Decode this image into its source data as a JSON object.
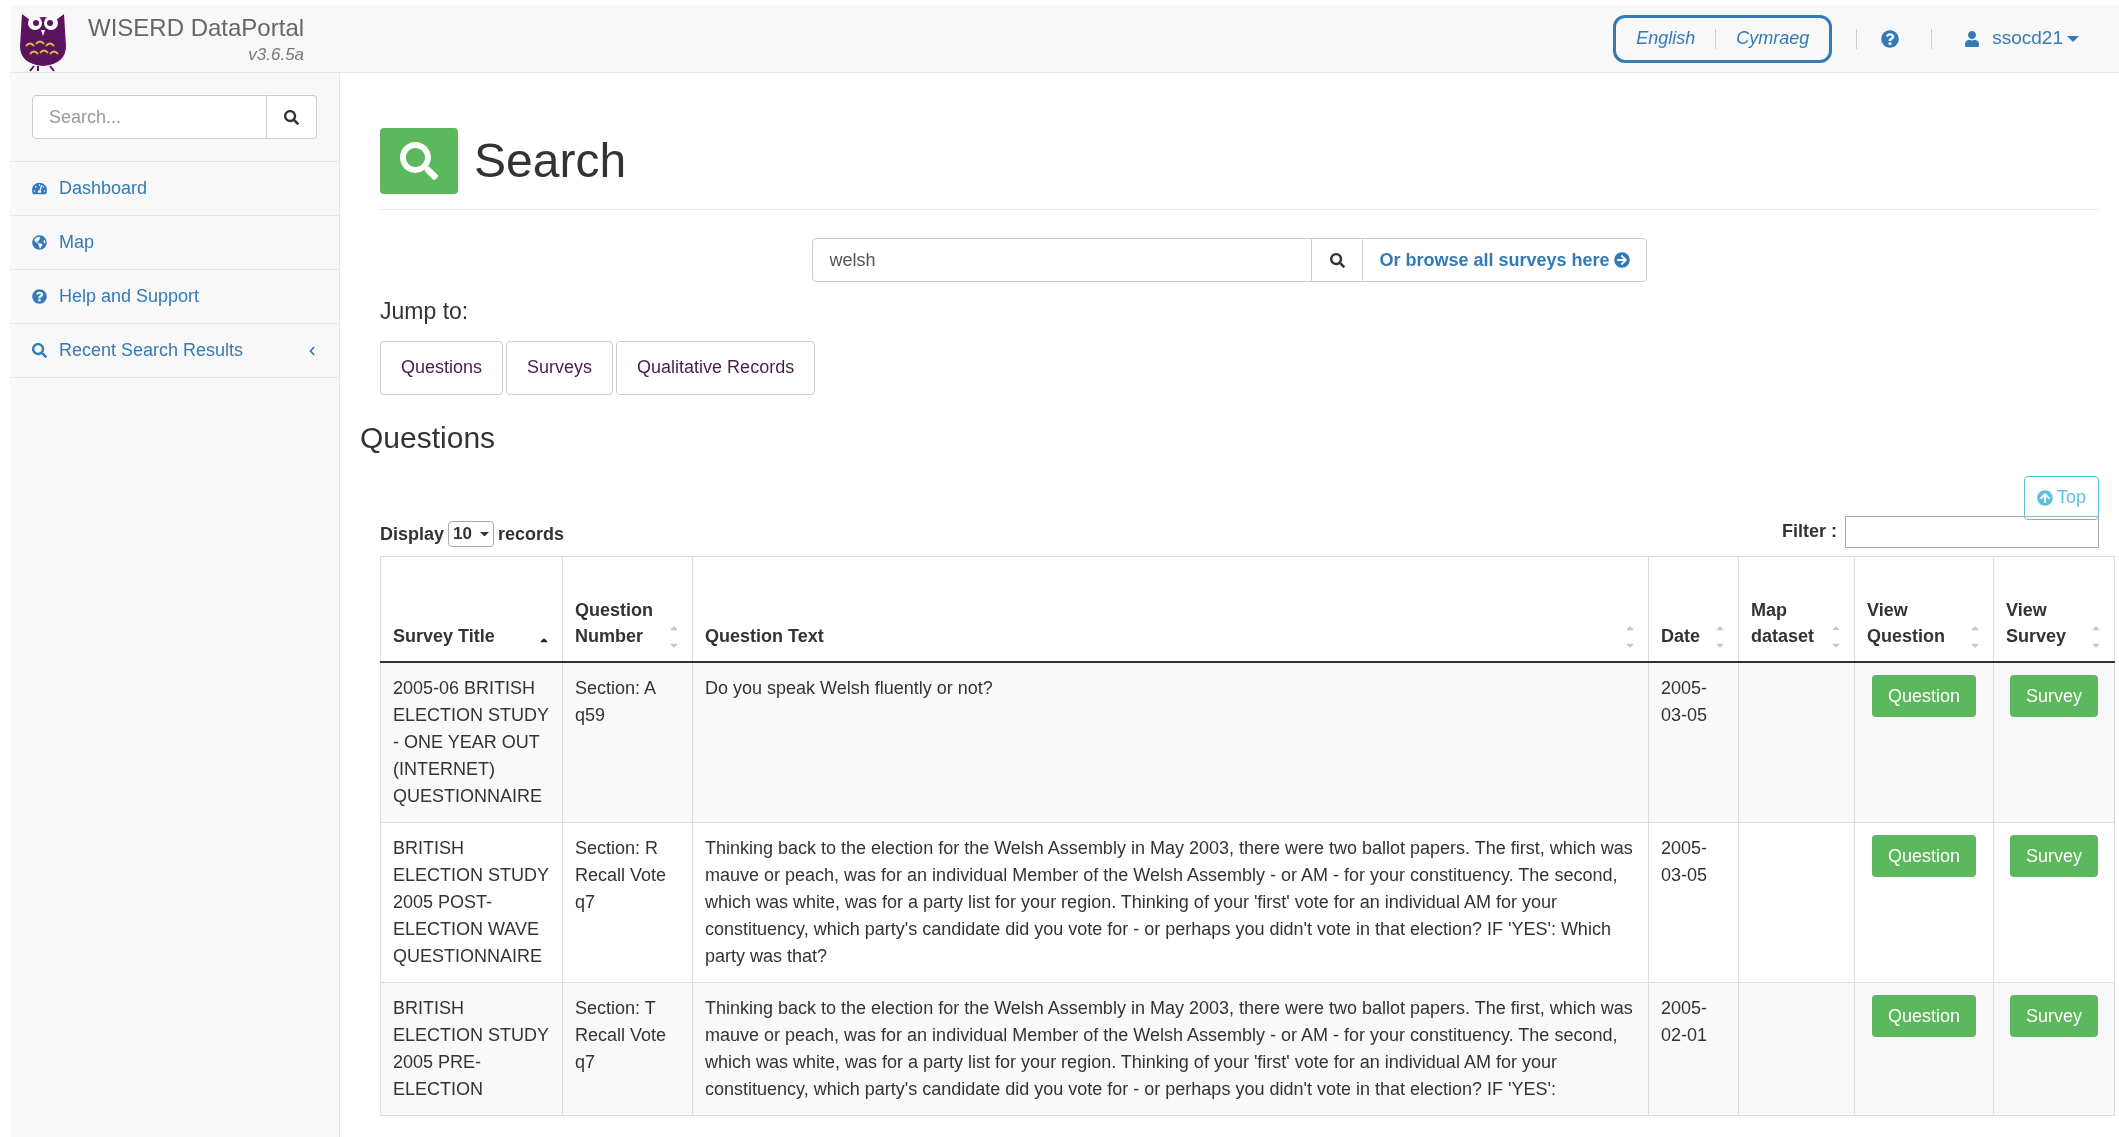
{
  "brand": {
    "title": "WISERD DataPortal",
    "version": "v3.6.5a"
  },
  "header": {
    "language_switch": {
      "focused": true,
      "languages": [
        "English",
        "Cymraeg"
      ]
    },
    "user": "ssocd21"
  },
  "sidebar": {
    "search_placeholder": "Search...",
    "items": [
      {
        "label": "Dashboard",
        "collapsible": false
      },
      {
        "label": "Map",
        "collapsible": false
      },
      {
        "label": "Help and Support",
        "collapsible": false
      },
      {
        "label": "Recent Search Results",
        "collapsible": true
      }
    ]
  },
  "page": {
    "title": "Search",
    "query": "welsh",
    "browse_link": "Or browse all surveys here",
    "jump_label": "Jump to:",
    "jump_buttons": [
      "Questions",
      "Surveys",
      "Qualitative Records"
    ],
    "section_title": "Questions",
    "top_button": "Top"
  },
  "table_controls": {
    "display_label": "Display",
    "page_size": "10",
    "records_label": "records",
    "filter_label": "Filter :"
  },
  "table": {
    "columns": [
      {
        "label": "Survey Title",
        "sorted": true
      },
      {
        "label": "Question Number",
        "sorted": false
      },
      {
        "label": "Question Text",
        "sorted": false
      },
      {
        "label": "Date",
        "sorted": false
      },
      {
        "label": "Map dataset",
        "sorted": false
      },
      {
        "label": "View Question",
        "sorted": false
      },
      {
        "label": "View Survey",
        "sorted": false
      }
    ],
    "rows": [
      {
        "survey_title": "2005-06 BRITISH ELECTION STUDY - ONE YEAR OUT (INTERNET) QUESTIONNAIRE",
        "question_number": "Section: A q59",
        "question_text": "Do you speak Welsh fluently or not?",
        "date": "2005-03-05",
        "question_button": "Question",
        "survey_button": "Survey"
      },
      {
        "survey_title": "BRITISH ELECTION STUDY 2005 POST-ELECTION WAVE QUESTIONNAIRE",
        "question_number": "Section: R Recall Vote q7",
        "question_text": "Thinking back to the election for the Welsh Assembly in May 2003, there were two ballot papers. The first, which was mauve or peach, was for an individual Member of the Welsh Assembly - or AM - for your constituency. The second, which was white, was for a party list for your region. Thinking of your 'first' vote for an individual AM for your constituency, which party's candidate did you vote for - or perhaps you didn't vote in that election? IF 'YES': Which party was that?",
        "date": "2005-03-05",
        "question_button": "Question",
        "survey_button": "Survey"
      },
      {
        "survey_title": "BRITISH ELECTION STUDY 2005 PRE-ELECTION",
        "question_number": "Section: T Recall Vote q7",
        "question_text": "Thinking back to the election for the Welsh Assembly in May 2003, there were two ballot papers. The first, which was mauve or peach, was for an individual Member of the Welsh Assembly - or AM - for your constituency. The second, which was white, was for a party list for your region. Thinking of your 'first' vote for an individual AM for your constituency, which party's candidate did you vote for - or perhaps you didn't vote in that election? IF 'YES':",
        "date": "2005-02-01",
        "question_button": "Question",
        "survey_button": "Survey"
      }
    ]
  }
}
